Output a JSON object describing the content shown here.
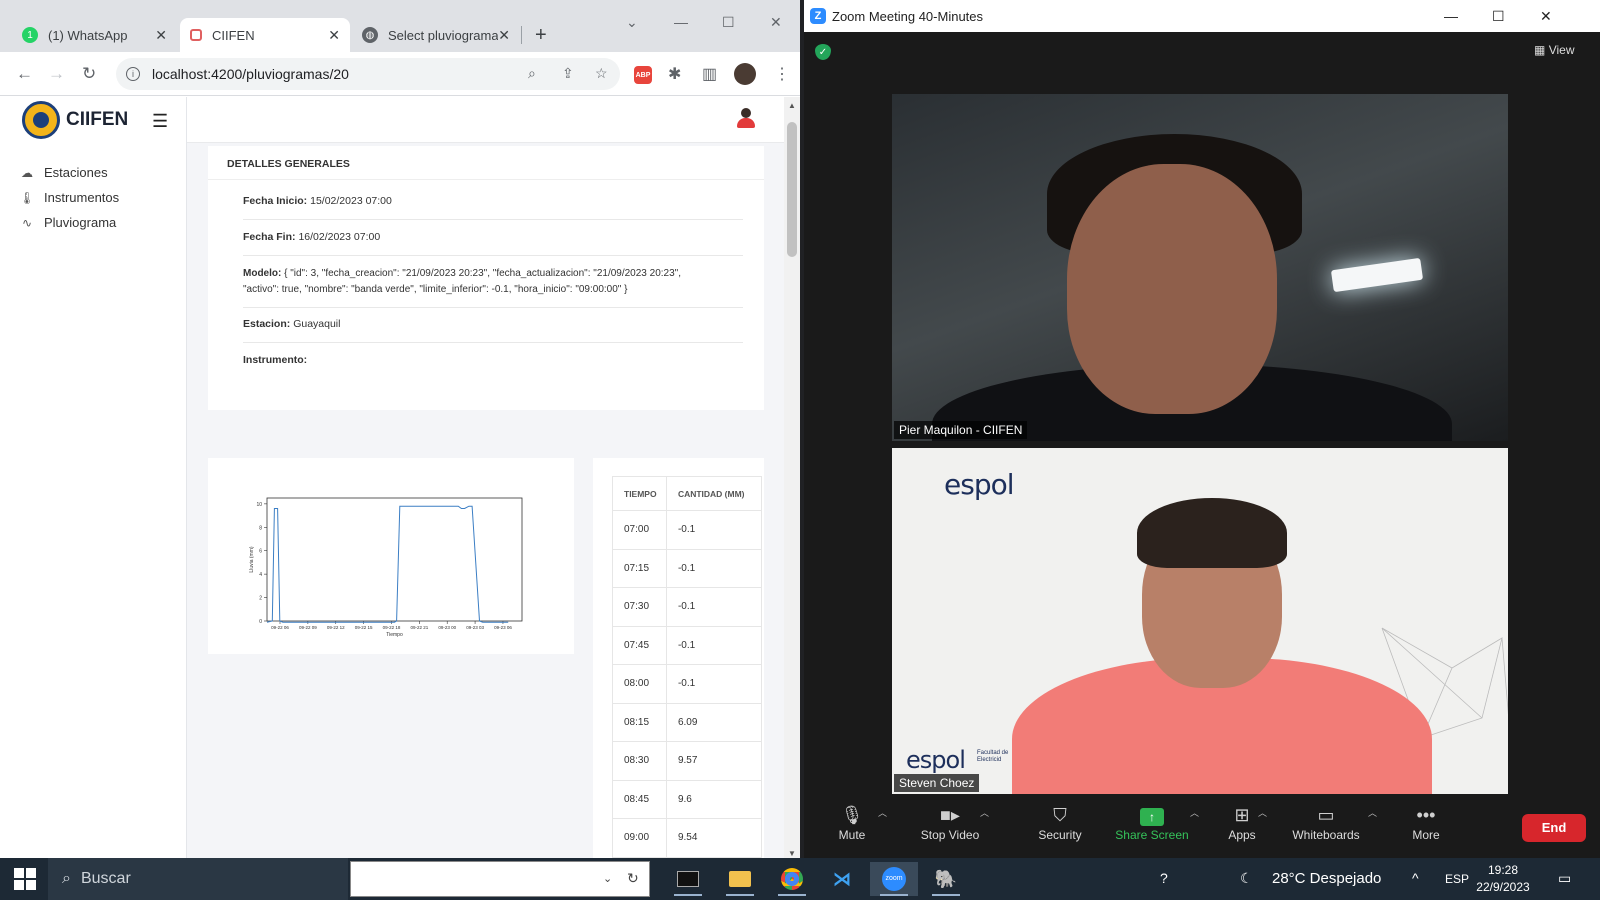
{
  "chrome": {
    "tabs": [
      {
        "label": "(1) WhatsApp",
        "icon": "whatsapp-icon"
      },
      {
        "label": "CIIFEN",
        "icon": "ciifen-icon"
      },
      {
        "label": "Select pluviograma",
        "icon": "globe-icon"
      }
    ],
    "new_tab": "+",
    "url": "localhost:4200/pluviogramas/20"
  },
  "app": {
    "brand": "CIIFEN",
    "nav": [
      {
        "label": "Estaciones",
        "icon": "cloud-icon"
      },
      {
        "label": "Instrumentos",
        "icon": "thermometer-icon"
      },
      {
        "label": "Pluviograma",
        "icon": "activity-icon"
      }
    ],
    "details": {
      "header": "DETALLES GENERALES",
      "fecha_inicio_label": "Fecha Inicio:",
      "fecha_inicio": "15/02/2023 07:00",
      "fecha_fin_label": "Fecha Fin:",
      "fecha_fin": "16/02/2023 07:00",
      "modelo_label": "Modelo:",
      "modelo_line1": "{ \"id\": 3, \"fecha_creacion\": \"21/09/2023 20:23\", \"fecha_actualizacion\": \"21/09/2023 20:23\",",
      "modelo_line2": "\"activo\": true, \"nombre\": \"banda verde\", \"limite_inferior\": -0.1, \"hora_inicio\": \"09:00:00\" }",
      "estacion_label": "Estacion:",
      "estacion": "Guayaquil",
      "instrumento_label": "Instrumento:",
      "instrumento": ""
    },
    "table": {
      "headers": [
        "TIEMPO",
        "CANTIDAD (MM)"
      ],
      "rows": [
        [
          "07:00",
          "-0.1"
        ],
        [
          "07:15",
          "-0.1"
        ],
        [
          "07:30",
          "-0.1"
        ],
        [
          "07:45",
          "-0.1"
        ],
        [
          "08:00",
          "-0.1"
        ],
        [
          "08:15",
          "6.09"
        ],
        [
          "08:30",
          "9.57"
        ],
        [
          "08:45",
          "9.6"
        ],
        [
          "09:00",
          "9.54"
        ]
      ]
    }
  },
  "chart_data": {
    "type": "line",
    "title": "",
    "xlabel": "Tiempo",
    "ylabel": "Lluvia (mm)",
    "x_ticks": [
      "09-22 06",
      "09-22 09",
      "09-22 12",
      "09-22 15",
      "09-22 18",
      "09-22 21",
      "09-23 00",
      "09-23 03",
      "09-23 06"
    ],
    "y_ticks": [
      0,
      2,
      4,
      6,
      8,
      10
    ],
    "ylim": [
      0,
      10.5
    ],
    "x_hours": [
      6,
      6.5,
      6.7,
      7.0,
      7.2,
      7.5,
      18.0,
      18.2,
      18.5,
      23.5,
      24.0,
      24.3,
      24.6,
      25.0,
      25.3,
      26.0,
      26.3,
      28.7
    ],
    "y_values": [
      -0.1,
      0,
      9.6,
      9.6,
      0,
      -0.1,
      -0.1,
      0,
      9.8,
      9.8,
      9.8,
      9.6,
      9.6,
      9.8,
      9.8,
      0,
      -0.1,
      -0.1
    ],
    "line_color": "#3b7ec4"
  },
  "zoom": {
    "title": "Zoom Meeting 40-Minutes",
    "view_label": "View",
    "participant1": "Pier Maquilon - CIIFEN",
    "participant2": "Steven Choez",
    "video2_logo": "espol",
    "video2_logo_small": "espol",
    "video2_logo_caption": "Facultad de\nElectricid",
    "toolbar": [
      {
        "label": "Mute",
        "icon": "microphone-icon"
      },
      {
        "label": "Stop Video",
        "icon": "video-camera-icon"
      },
      {
        "label": "Security",
        "icon": "shield-icon"
      },
      {
        "label": "Share Screen",
        "icon": "share-screen-icon"
      },
      {
        "label": "Apps",
        "icon": "apps-icon"
      },
      {
        "label": "Whiteboards",
        "icon": "whiteboard-icon"
      },
      {
        "label": "More",
        "icon": "more-icon"
      }
    ],
    "end_label": "End"
  },
  "taskbar": {
    "search": "Buscar",
    "weather": "28°C  Despejado",
    "lang": "ESP",
    "time": "19:28",
    "date": "22/9/2023"
  }
}
